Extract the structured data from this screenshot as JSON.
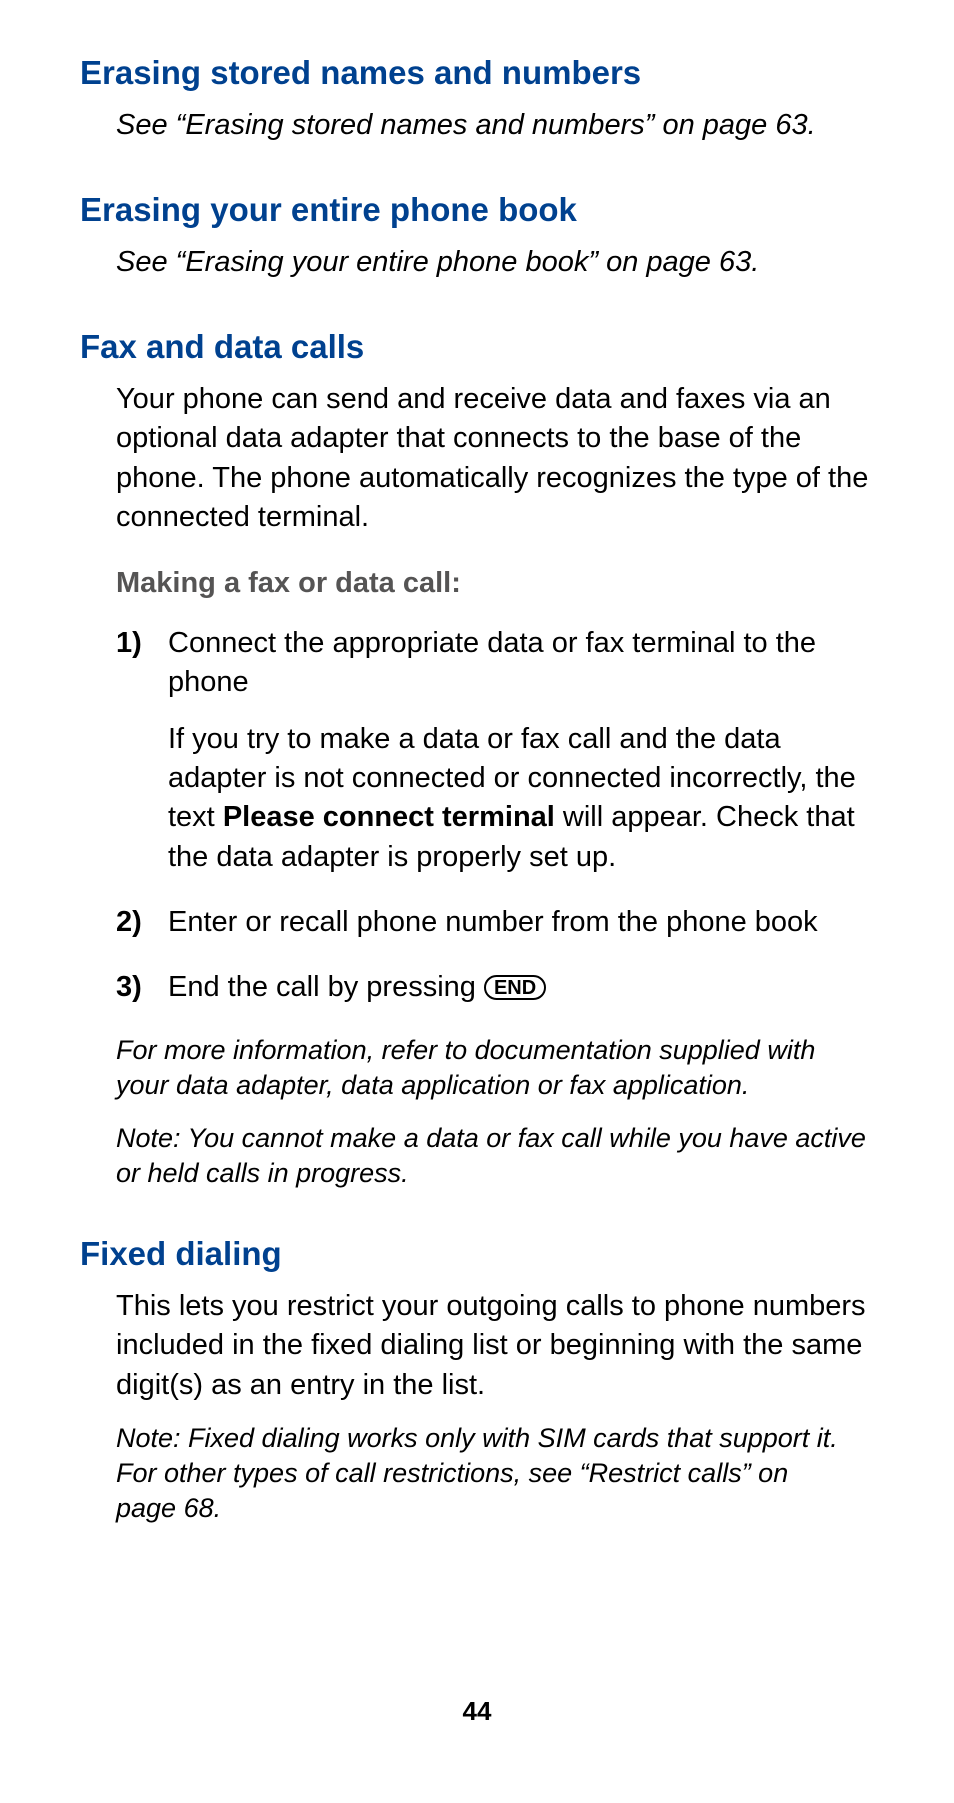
{
  "sections": {
    "erase_names": {
      "heading": "Erasing stored names and numbers",
      "body_italic": "See “Erasing stored names and numbers” on page 63."
    },
    "erase_book": {
      "heading": "Erasing your entire phone book",
      "body_italic": "See “Erasing your entire phone book” on page 63."
    },
    "fax_data": {
      "heading": "Fax and data calls",
      "intro": "Your phone can send and receive data and faxes via an optional data adapter that connects to the base of the phone. The phone automatically recognizes the type of the connected terminal.",
      "sub_heading": "Making a fax or data call:",
      "steps": [
        {
          "num": "1)",
          "p1": "Connect the appropriate data or fax terminal to the phone",
          "p2_pre": "If you try to make a data or fax call and the data adapter is not connected or connected incorrectly, the text ",
          "p2_bold": "Please connect terminal",
          "p2_post": " will appear. Check that the data adapter is properly set up."
        },
        {
          "num": "2)",
          "p1": "Enter or recall phone number from the phone book"
        },
        {
          "num": "3)",
          "p1_pre": "End the call by pressing ",
          "btn": "END"
        }
      ],
      "note1": "For more information, refer to documentation supplied with your data adapter, data application or fax application.",
      "note2": "Note: You cannot make a data or fax call while you have active or held calls in progress."
    },
    "fixed_dialing": {
      "heading": "Fixed dialing",
      "body": "This lets you restrict your outgoing calls to phone numbers included in the fixed dialing list or beginning with the same digit(s) as an entry in the list.",
      "note": "Note: Fixed dialing works only with SIM cards that support it. For other types of call restrictions, see “Restrict calls” on page 68."
    }
  },
  "page_number": "44"
}
